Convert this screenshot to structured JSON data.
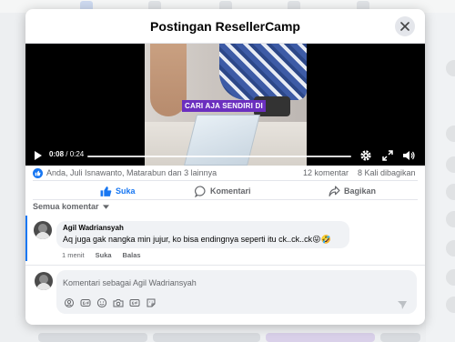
{
  "modal": {
    "title": "Postingan ResellerCamp"
  },
  "video": {
    "caption": "CARI AJA SENDIRI DI",
    "current_time": "0:08",
    "separator": " / ",
    "duration": "0:24",
    "progress": 0.0
  },
  "stats": {
    "reactors": "Anda, Juli Isnawanto, Matarabun dan 3 lainnya",
    "comments": "12 komentar",
    "shares": "8 Kali dibagikan"
  },
  "actions": {
    "like": "Suka",
    "comment": "Komentari",
    "share": "Bagikan"
  },
  "filter_label": "Semua komentar",
  "comment": {
    "author": "Agil Wadriansyah",
    "text": "Aq juga gak nangka min jujur, ko bisa endingnya seperti itu ck..ck..ck😜🤣",
    "time": "1 menit",
    "like": "Suka",
    "reply": "Balas"
  },
  "composer": {
    "placeholder": "Komentari sebagai Agil Wadriansyah"
  },
  "colors": {
    "accent": "#1877f2",
    "caption_bg": "#6b2fbf"
  }
}
